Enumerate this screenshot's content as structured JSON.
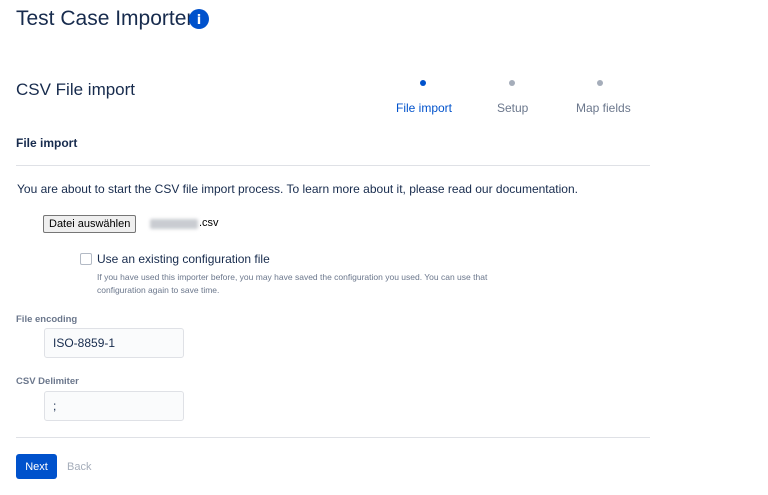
{
  "header": {
    "title": "Test Case Importer",
    "info_icon": "info-icon",
    "info_glyph": "i",
    "accent_color": "#0052cc"
  },
  "section": {
    "title": "CSV File import"
  },
  "steps": [
    {
      "label": "File import",
      "active": true
    },
    {
      "label": "Setup",
      "active": false
    },
    {
      "label": "Map fields",
      "active": false
    }
  ],
  "subsection": {
    "title": "File import"
  },
  "intro": {
    "text": "You are about to start the CSV file import process. To learn more about it, please read our documentation."
  },
  "file_picker": {
    "button_label": "Datei auswählen",
    "file_extension": ".csv"
  },
  "config_option": {
    "label": "Use an existing configuration file",
    "help": "If you have used this importer before, you may have saved the configuration you used. You can use that configuration again to save time.",
    "checked": false
  },
  "encoding": {
    "label": "File encoding",
    "value": "ISO-8859-1"
  },
  "delimiter": {
    "label": "CSV Delimiter",
    "value": ";"
  },
  "actions": {
    "next_label": "Next",
    "back_label": "Back"
  }
}
